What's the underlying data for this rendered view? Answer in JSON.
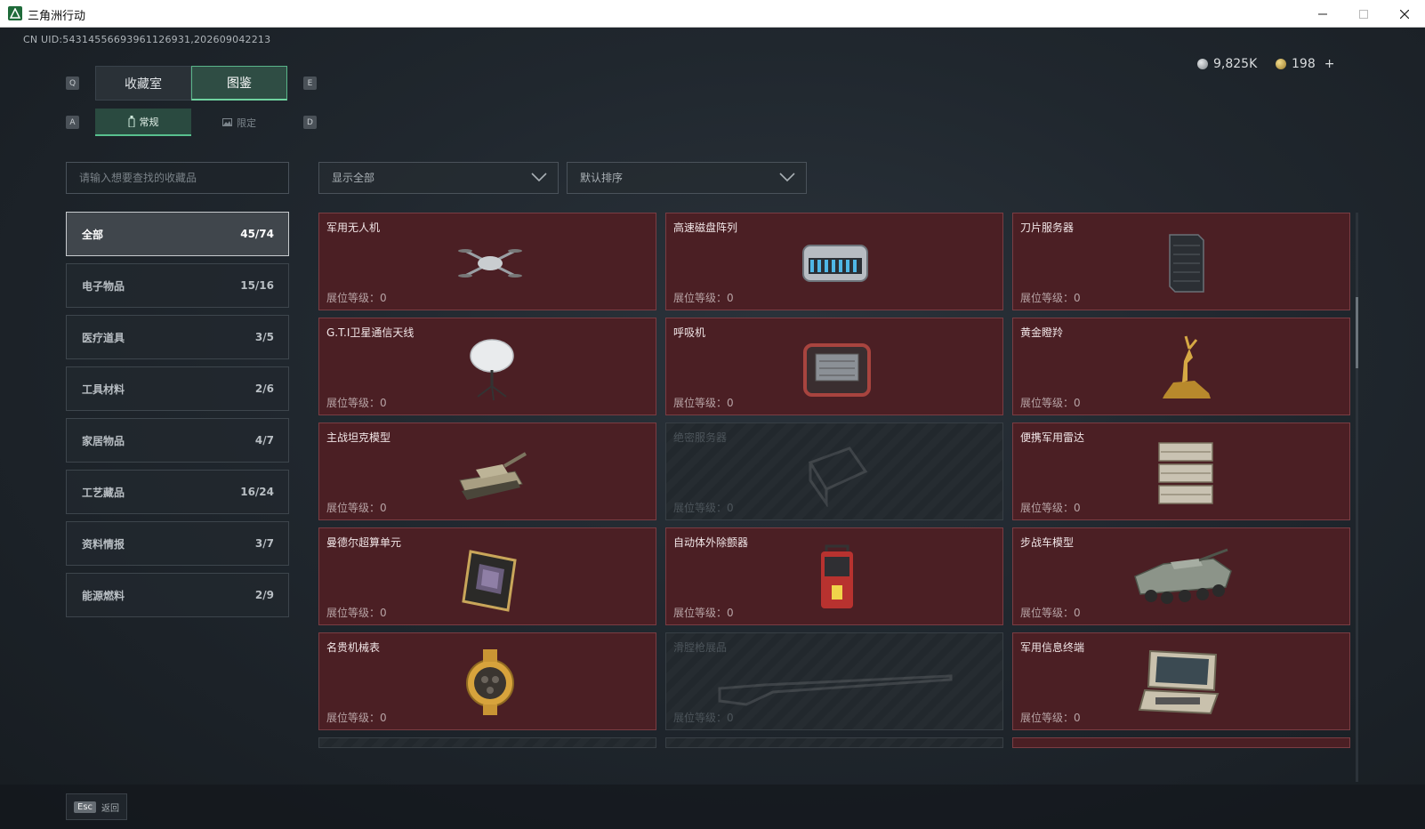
{
  "window": {
    "title": "三角洲行动"
  },
  "uid": "CN UID:54314556693961126931,202609042213",
  "currency": {
    "silver": "9,825K",
    "gold": "198",
    "add": "+"
  },
  "keyhints": {
    "prev_main": "Q",
    "next_main": "E",
    "prev_sub": "A",
    "next_sub": "D"
  },
  "main_tabs": [
    {
      "label": "收藏室"
    },
    {
      "label": "图鉴"
    }
  ],
  "sub_tabs": [
    {
      "label": "常规"
    },
    {
      "label": "限定"
    }
  ],
  "search": {
    "placeholder": "请输入想要查找的收藏品"
  },
  "filters": {
    "show": "显示全部",
    "sort": "默认排序"
  },
  "categories": [
    {
      "label": "全部",
      "count": "45/74"
    },
    {
      "label": "电子物品",
      "count": "15/16"
    },
    {
      "label": "医疗道具",
      "count": "3/5"
    },
    {
      "label": "工具材料",
      "count": "2/6"
    },
    {
      "label": "家居物品",
      "count": "4/7"
    },
    {
      "label": "工艺藏品",
      "count": "16/24"
    },
    {
      "label": "资料情报",
      "count": "3/7"
    },
    {
      "label": "能源燃料",
      "count": "2/9"
    }
  ],
  "level_label": "展位等级：0",
  "items": [
    {
      "name": "军用无人机",
      "icon": "drone-icon"
    },
    {
      "name": "高速磁盘阵列",
      "icon": "disk-array-icon"
    },
    {
      "name": "刀片服务器",
      "icon": "server-icon"
    },
    {
      "name": "G.T.I卫星通信天线",
      "icon": "satellite-dish-icon"
    },
    {
      "name": "呼吸机",
      "icon": "ventilator-icon"
    },
    {
      "name": "黄金瞪羚",
      "icon": "gold-gazelle-icon"
    },
    {
      "name": "主战坦克模型",
      "icon": "tank-icon"
    },
    {
      "name": "绝密服务器",
      "icon": "secret-server-icon"
    },
    {
      "name": "便携军用雷达",
      "icon": "radar-icon"
    },
    {
      "name": "曼德尔超算单元",
      "icon": "cpu-icon"
    },
    {
      "name": "自动体外除颤器",
      "icon": "defibrillator-icon"
    },
    {
      "name": "步战车模型",
      "icon": "ifv-icon"
    },
    {
      "name": "名贵机械表",
      "icon": "watch-icon"
    },
    {
      "name": "滑膛枪展品",
      "icon": "musket-icon"
    },
    {
      "name": "军用信息终端",
      "icon": "terminal-icon"
    }
  ],
  "footer": {
    "key": "Esc",
    "label": "返回"
  },
  "colors": {
    "accent": "#6fd3a0",
    "card_bg": "#4b1f24",
    "card_border": "#7a3d43"
  }
}
